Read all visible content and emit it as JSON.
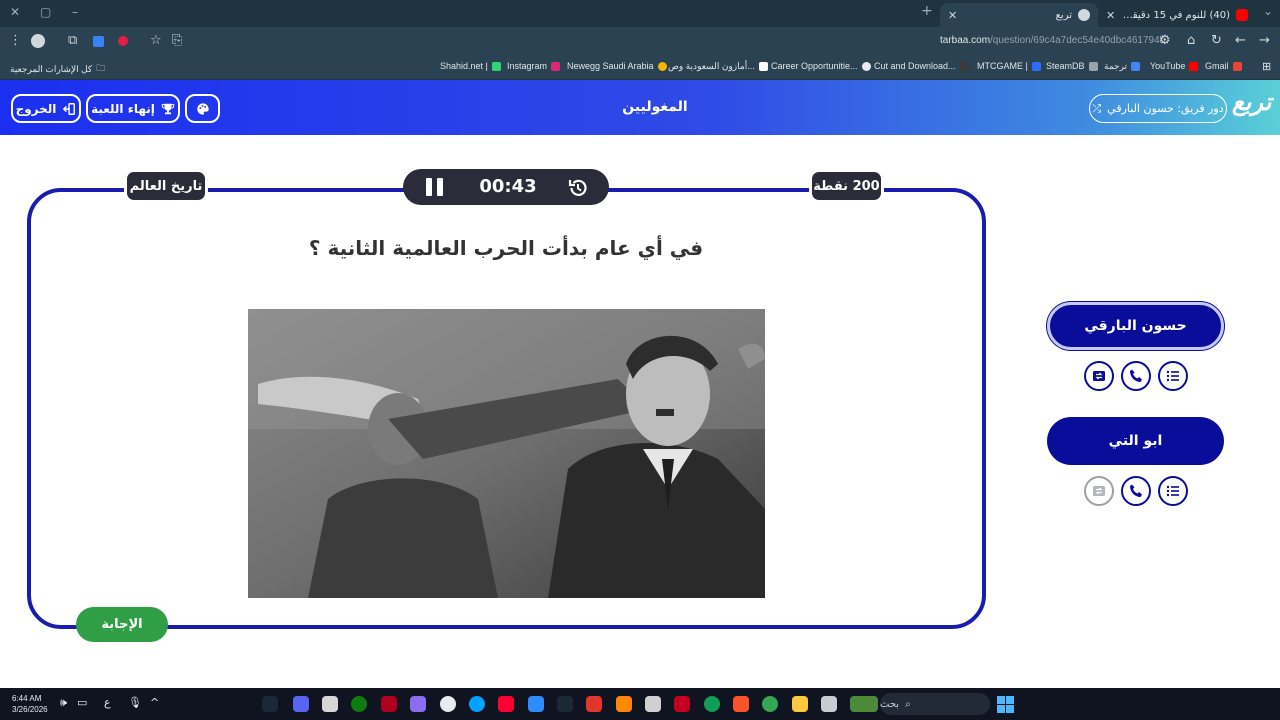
{
  "browser": {
    "tabs": [
      {
        "title": "(40) للنوم في 15 دقيقة مع صوت...",
        "favicon_color": "#ff0000",
        "active": false
      },
      {
        "title": "تربع",
        "favicon_color": "#cfd8dc",
        "active": true
      }
    ],
    "new_tab_label": "+",
    "url_host": "tarbaa.com",
    "url_path": "/question/69c4a7dec54e40dbc461794b",
    "bookmarks": [
      {
        "label": "Gmail",
        "color": "#ea4335"
      },
      {
        "label": "YouTube",
        "color": "#ff0000"
      },
      {
        "label": "ترجمة",
        "color": "#4285f4"
      },
      {
        "label": "SteamDB",
        "color": "#9aa4ad"
      },
      {
        "label": "MTCGAME |",
        "color": "#2b6cff"
      },
      {
        "label": "Cut and Download...",
        "color": "#3b3b3b"
      },
      {
        "label": "Career Opportunitie...",
        "color": "#e8ecf2"
      },
      {
        "label": "أمازون السعودية وص...",
        "color": "#ffffff"
      },
      {
        "label": "Newegg Saudi Arabia",
        "color": "#f7b500"
      },
      {
        "label": "Instagram",
        "color": "#d62976"
      },
      {
        "label": "Shahid.net |",
        "color": "#2ed573"
      }
    ],
    "all_bookmarks_label": "كل الإشارات المرجعية"
  },
  "header": {
    "exit_label": "الخروج",
    "end_game_label": "إنهاء اللعبة",
    "category_title": "المغوليين",
    "turn_label": "دور فريق: حسون البارقي",
    "logo_text": "تربع"
  },
  "question": {
    "category_chip": "تاريخ العالم",
    "points_chip": "200 نقطة",
    "timer": "00:43",
    "text": "في أي عام بدأت الحرب العالمية الثانية ؟",
    "answer_button": "الإجابة"
  },
  "teams": [
    {
      "name": "حسون البارقي",
      "active": true,
      "aids": [
        {
          "icon": "list-icon",
          "used": false
        },
        {
          "icon": "phone-icon",
          "used": false
        },
        {
          "icon": "swap-card-icon",
          "used": false
        }
      ]
    },
    {
      "name": "ابو التي",
      "active": false,
      "aids": [
        {
          "icon": "list-icon",
          "used": false
        },
        {
          "icon": "phone-icon",
          "used": false
        },
        {
          "icon": "swap-card-icon",
          "used": true
        }
      ]
    }
  ],
  "taskbar": {
    "time": "6:44 AM",
    "date": "3/26/2026",
    "search_placeholder": "بحث",
    "language": "ع"
  }
}
